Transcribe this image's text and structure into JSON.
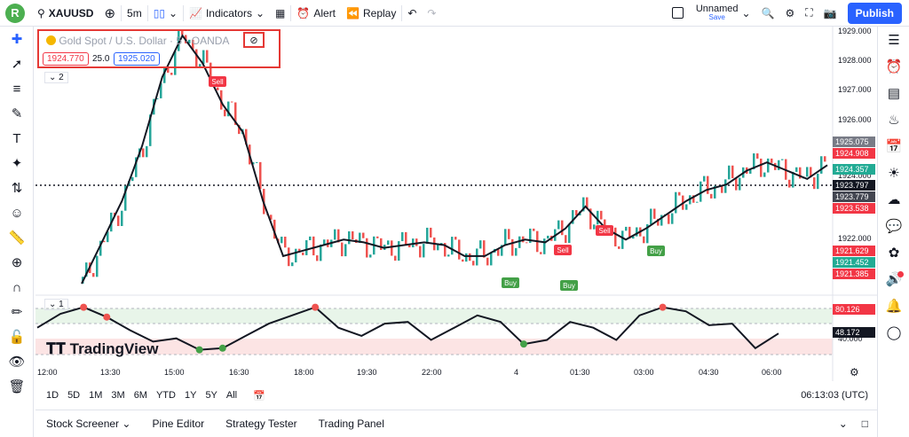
{
  "topbar": {
    "avatar_letter": "R",
    "symbol": "XAUUSD",
    "interval": "5m",
    "indicators_label": "Indicators",
    "alert_label": "Alert",
    "replay_label": "Replay",
    "layout_name": "Unnamed",
    "layout_status": "Save",
    "publish_label": "Publish"
  },
  "legend": {
    "title": "Gold Spot / U.S. Dollar · 5 · OANDA",
    "bid": "1924.770",
    "spread": "25.0",
    "ask": "1925.020",
    "indicator_count": "2"
  },
  "oscillator": {
    "pane_count": "1"
  },
  "watermark": "TradingView",
  "price_axis": {
    "ticks": [
      "1929.000",
      "1928.000",
      "1927.000",
      "1926.000",
      "1924.000",
      "1922.000",
      "40.000"
    ],
    "tags": [
      {
        "value": "1925.075",
        "color": "#787b86"
      },
      {
        "value": "1924.908",
        "color": "#f23645"
      },
      {
        "value": "1924.357",
        "color": "#22ab94"
      },
      {
        "value": "1923.797",
        "color": "#131722"
      },
      {
        "value": "1923.779",
        "color": "#434651"
      },
      {
        "value": "1923.538",
        "color": "#f23645"
      },
      {
        "value": "1921.629",
        "color": "#f23645"
      },
      {
        "value": "1921.452",
        "color": "#22ab94"
      },
      {
        "value": "1921.385",
        "color": "#f23645"
      },
      {
        "value": "80.126",
        "color": "#f23645"
      },
      {
        "value": "48.172",
        "color": "#131722"
      }
    ]
  },
  "time_axis": [
    "12:00",
    "13:30",
    "15:00",
    "16:30",
    "18:00",
    "19:30",
    "22:00",
    "4",
    "01:30",
    "03:00",
    "04:30",
    "06:00"
  ],
  "signals": [
    "Sell",
    "Sell",
    "Sell",
    "Buy",
    "Buy",
    "Buy"
  ],
  "timeframes": [
    "1D",
    "5D",
    "1M",
    "3M",
    "6M",
    "YTD",
    "1Y",
    "5Y",
    "All"
  ],
  "clock": "06:13:03 (UTC)",
  "bottom_tabs": [
    "Stock Screener",
    "Pine Editor",
    "Strategy Tester",
    "Trading Panel"
  ],
  "chart_data": {
    "type": "line",
    "series_price": [
      1920.0,
      1921.5,
      1923.0,
      1925.0,
      1927.5,
      1929.0,
      1928.0,
      1926.5,
      1925.5,
      1923.0,
      1921.0,
      1921.2,
      1921.4,
      1921.6,
      1921.5,
      1921.3,
      1921.4,
      1921.5,
      1921.4,
      1921.0,
      1921.0,
      1921.4,
      1921.6,
      1921.5,
      1922.0,
      1922.8,
      1922.0,
      1921.6,
      1922.0,
      1922.5,
      1923.0,
      1923.4,
      1923.6,
      1924.1,
      1924.4,
      1924.1,
      1923.8,
      1924.3
    ],
    "series_osc": [
      55,
      72,
      80,
      68,
      52,
      38,
      42,
      28,
      30,
      45,
      60,
      70,
      80,
      55,
      45,
      60,
      62,
      40,
      55,
      70,
      62,
      35,
      40,
      62,
      55,
      40,
      70,
      80,
      75,
      58,
      60,
      30,
      48
    ],
    "osc_levels": [
      80.126,
      48.172,
      40.0
    ]
  }
}
